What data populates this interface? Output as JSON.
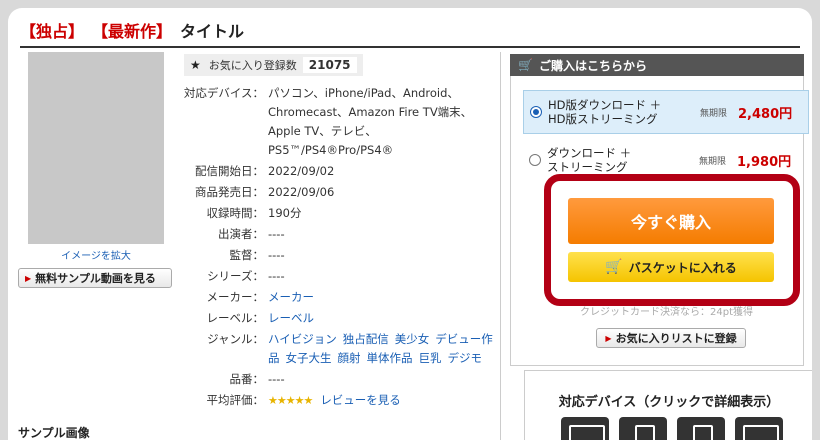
{
  "title": {
    "tag1": "【独占】",
    "tag2": "【最新作】",
    "text": "タイトル"
  },
  "left": {
    "enlarge": "イメージを拡大",
    "sample_button": "無料サンプル動画を見る",
    "sample_heading": "サンプル画像"
  },
  "favorite": {
    "label": "お気に入り登録数",
    "count": "21075"
  },
  "info": {
    "devices_label": "対応デバイス：",
    "devices": "パソコン、iPhone/iPad、Android、Chromecast、Amazon Fire TV端末、Apple TV、テレビ、PS5™/PS4®Pro/PS4®",
    "start_label": "配信開始日：",
    "start": "2022/09/02",
    "release_label": "商品発売日：",
    "release": "2022/09/06",
    "duration_label": "収録時間：",
    "duration": "190分",
    "cast_label": "出演者：",
    "cast": "----",
    "director_label": "監督：",
    "director": "----",
    "series_label": "シリーズ：",
    "series": "----",
    "maker_label": "メーカー：",
    "maker": "メーカー",
    "label_label": "レーベル：",
    "label": "レーベル",
    "genre_label": "ジャンル：",
    "genres": [
      "ハイビジョン",
      "独占配信",
      "美少女",
      "デビュー作品",
      "女子大生",
      "顔射",
      "単体作品",
      "巨乳",
      "デジモ"
    ],
    "code_label": "品番：",
    "code": "----",
    "rating_label": "平均評価：",
    "rating_stars": "★★★★★",
    "review_link": "レビューを見る"
  },
  "purchase": {
    "heading": "ご購入はこちらから",
    "options": [
      {
        "label1": "HD版ダウンロード ＋",
        "label2": "HD版ストリーミング",
        "limit": "無期限",
        "price": "2,480円",
        "selected": true
      },
      {
        "label1": "ダウンロード ＋",
        "label2": "ストリーミング",
        "limit": "無期限",
        "price": "1,980円",
        "selected": false
      }
    ],
    "buy_now": "今すぐ購入",
    "basket": "バスケットに入れる",
    "card_note": "クレジットカード決済なら：24pt獲得",
    "add_favorite": "お気に入りリストに登録"
  },
  "devices_panel": {
    "title": "対応デバイス（クリックで詳細表示）"
  }
}
